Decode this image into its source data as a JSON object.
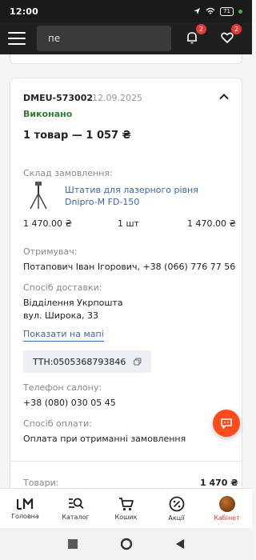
{
  "status_bar": {
    "time": "12:00",
    "battery": "71"
  },
  "header": {
    "search_value": "пе",
    "notifications_count": "2",
    "favorites_count": "2"
  },
  "order": {
    "id": "DMEU-573002",
    "date": "12.09.2025",
    "status": "Виконано",
    "summary": "1 товар — 1 057 ₴",
    "composition_label": "Склад замовлення:",
    "product": {
      "name": "Штатив для лазерного рівня Dnipro-M FD-150",
      "price": "1 470.00 ₴",
      "quantity": "1 шт",
      "total": "1 470.00 ₴"
    },
    "recipient_label": "Отримувач:",
    "recipient_value": "Потапович Іван Ігорович, +38 (066) 776 77 56",
    "delivery_label": "Спосіб доставки:",
    "delivery_line1": "Відділення Укрпошта",
    "delivery_line2": "вул. Широка, 33",
    "map_link": "Показати на мапі",
    "ttn": "ТТН:0505368793846",
    "salon_phone_label": "Телефон салону:",
    "salon_phone_value": "+38 (080) 030 05 45",
    "payment_label": "Спосіб оплати:",
    "payment_value": "Оплата при отриманні замовлення",
    "goods_label": "Товари:",
    "goods_value": "1 470 ₴"
  },
  "bottom_nav": {
    "items": [
      {
        "label": "Головна"
      },
      {
        "label": "Каталог"
      },
      {
        "label": "Кошик"
      },
      {
        "label": "Акції"
      },
      {
        "label": "Кабінет"
      }
    ],
    "active_color": "#e53935"
  },
  "colors": {
    "accent": "#ff4a1c",
    "success": "#2e7d32",
    "link": "#3b66a8"
  }
}
